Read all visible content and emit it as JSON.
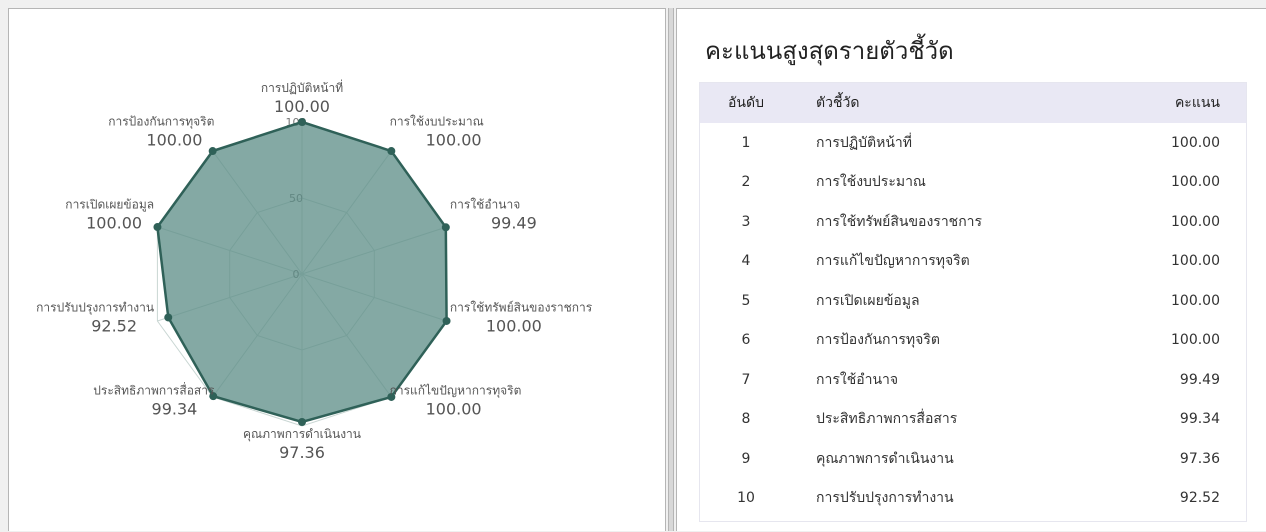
{
  "chart_data": {
    "type": "radar",
    "title": "",
    "axes": [
      {
        "label": "การปฏิบัติหน้าที่",
        "value": 100.0,
        "display": "100.00"
      },
      {
        "label": "การใช้งบประมาณ",
        "value": 100.0,
        "display": "100.00"
      },
      {
        "label": "การใช้อำนาจ",
        "value": 99.49,
        "display": "99.49"
      },
      {
        "label": "การใช้ทรัพย์สินของราชการ",
        "value": 100.0,
        "display": "100.00"
      },
      {
        "label": "การแก้ไขปัญหาการทุจริต",
        "value": 100.0,
        "display": "100.00"
      },
      {
        "label": "คุณภาพการดำเนินงาน",
        "value": 97.36,
        "display": "97.36"
      },
      {
        "label": "ประสิทธิภาพการสื่อสาร",
        "value": 99.34,
        "display": "99.34"
      },
      {
        "label": "การปรับปรุงการทำงาน",
        "value": 92.52,
        "display": "92.52"
      },
      {
        "label": "การเปิดเผยข้อมูล",
        "value": 100.0,
        "display": "100.00"
      },
      {
        "label": "การป้องกันการทุจริต",
        "value": 100.0,
        "display": "100.00"
      }
    ],
    "rlim": [
      0,
      100
    ],
    "radial_ticks": [
      "0",
      "50",
      "100"
    ],
    "colors": {
      "fill": "#5b8c85",
      "stroke": "#2f6158",
      "grid": "#c9d6d3"
    }
  },
  "ranking": {
    "title": "คะแนนสูงสุดรายตัวชี้วัด",
    "headers": {
      "rank": "อันดับ",
      "indicator": "ตัวชี้วัด",
      "score": "คะแนน"
    },
    "rows": [
      {
        "rank": "1",
        "indicator": "การปฏิบัติหน้าที่",
        "score": "100.00"
      },
      {
        "rank": "2",
        "indicator": "การใช้งบประมาณ",
        "score": "100.00"
      },
      {
        "rank": "3",
        "indicator": "การใช้ทรัพย์สินของราชการ",
        "score": "100.00"
      },
      {
        "rank": "4",
        "indicator": "การแก้ไขปัญหาการทุจริต",
        "score": "100.00"
      },
      {
        "rank": "5",
        "indicator": "การเปิดเผยข้อมูล",
        "score": "100.00"
      },
      {
        "rank": "6",
        "indicator": "การป้องกันการทุจริต",
        "score": "100.00"
      },
      {
        "rank": "7",
        "indicator": "การใช้อำนาจ",
        "score": "99.49"
      },
      {
        "rank": "8",
        "indicator": "ประสิทธิภาพการสื่อสาร",
        "score": "99.34"
      },
      {
        "rank": "9",
        "indicator": "คุณภาพการดำเนินงาน",
        "score": "97.36"
      },
      {
        "rank": "10",
        "indicator": "การปรับปรุงการทำงาน",
        "score": "92.52"
      }
    ]
  }
}
